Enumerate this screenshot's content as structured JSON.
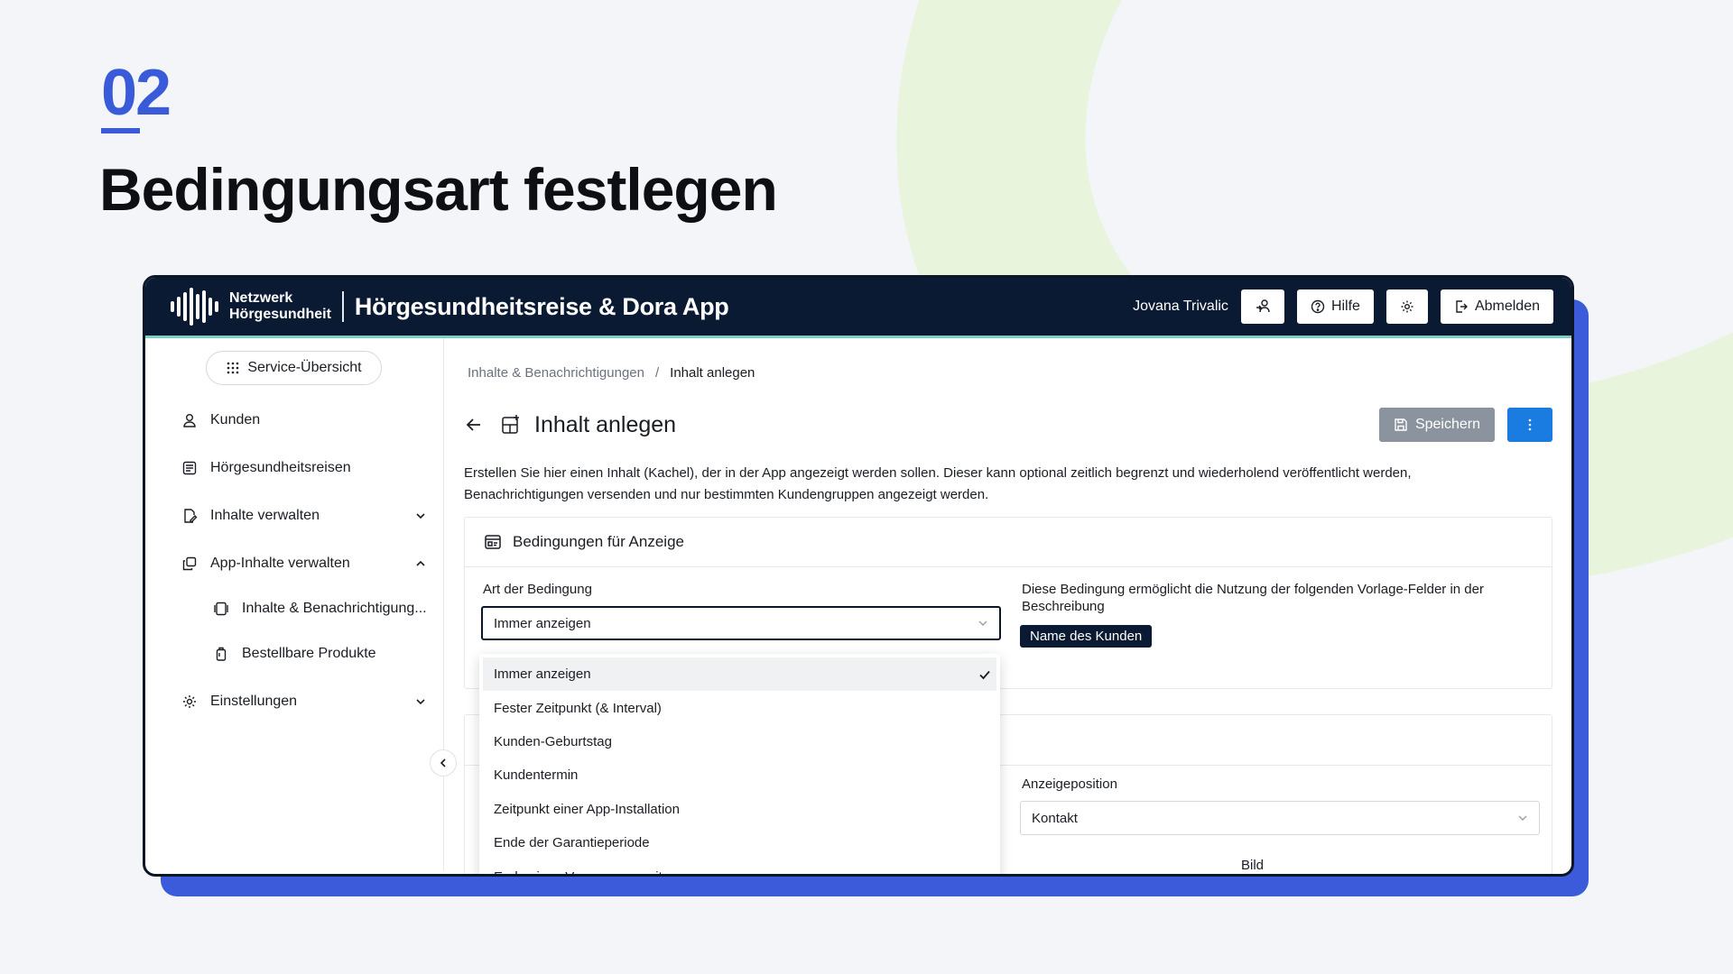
{
  "slide": {
    "step_number": "02",
    "title": "Bedingungsart festlegen"
  },
  "topbar": {
    "logo_line1": "Netzwerk",
    "logo_line2": "Hörgesundheit",
    "app_title": "Hörgesundheitsreise & Dora App",
    "user_name": "Jovana Trivalic",
    "help_label": "Hilfe",
    "logout_label": "Abmelden"
  },
  "sidebar": {
    "service_label": "Service-Übersicht",
    "items": [
      {
        "label": "Kunden",
        "icon": "user-icon"
      },
      {
        "label": "Hörgesundheitsreisen",
        "icon": "journey-icon"
      },
      {
        "label": "Inhalte verwalten",
        "icon": "edit-document-icon"
      },
      {
        "label": "App-Inhalte verwalten",
        "icon": "app-content-icon"
      },
      {
        "label": "Inhalte & Benachrichtigung...",
        "icon": "tiles-icon"
      },
      {
        "label": "Bestellbare Produkte",
        "icon": "product-icon"
      },
      {
        "label": "Einstellungen",
        "icon": "gear-icon"
      }
    ]
  },
  "main": {
    "breadcrumb": [
      "Inhalte & Benachrichtigungen",
      "/",
      "Inhalt anlegen"
    ],
    "page_title": "Inhalt anlegen",
    "save_label": "Speichern",
    "description_line1": "Erstellen Sie hier einen Inhalt (Kachel), der in der App angezeigt werden sollen. Dieser kann optional zeitlich begrenzt und wiederholend veröffentlicht werden,",
    "description_line2": "Benachrichtigungen versenden und nur bestimmten Kundengruppen angezeigt werden.",
    "panel_title": "Bedingungen für Anzeige",
    "condition_label": "Art der Bedingung",
    "condition_value": "Immer anzeigen",
    "hint_text": "Diese Bedingung ermöglicht die Nutzung der folgenden Vorlage-Felder in der Beschreibung",
    "tag_label": "Name des Kunden",
    "position_label": "Anzeigeposition",
    "position_value": "Kontakt",
    "image_label": "Bild"
  },
  "dropdown": {
    "options": [
      "Immer anzeigen",
      "Fester Zeitpunkt (& Interval)",
      "Kunden-Geburtstag",
      "Kundentermin",
      "Zeitpunkt einer App-Installation",
      "Ende der Garantieperiode",
      "Ende eines Versorgungszeitraums"
    ],
    "selected": "Immer anzeigen"
  },
  "colors": {
    "accent_blue": "#3a5bd9",
    "topbar_bg": "#0b1a33",
    "primary_button": "#1a7be0",
    "disabled_button": "#8a939e"
  }
}
